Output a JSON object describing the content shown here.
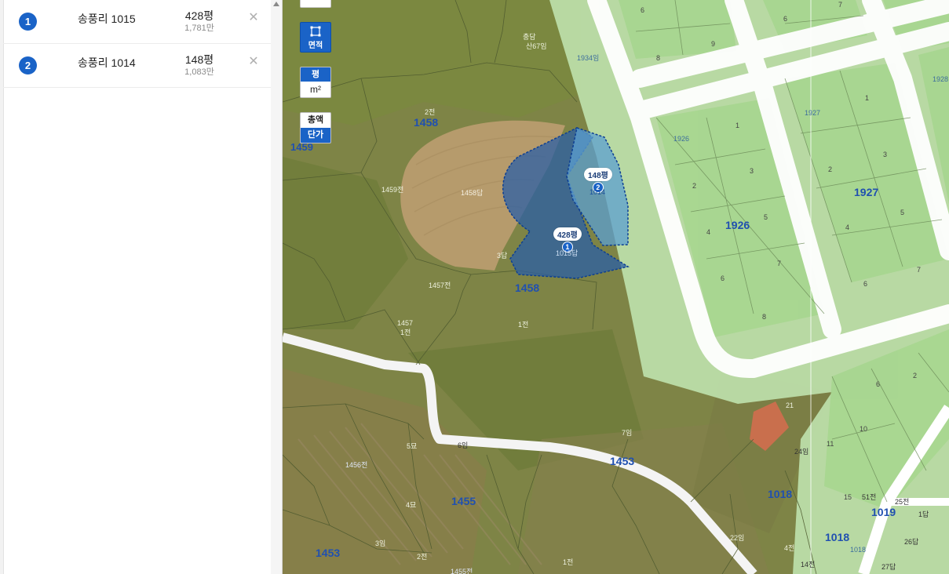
{
  "parcels": [
    {
      "index": "1",
      "name": "송풍리 1015",
      "area": "428평",
      "price": "1,781만"
    },
    {
      "index": "2",
      "name": "송풍리 1014",
      "area": "148평",
      "price": "1,083만"
    }
  ],
  "toolbar": {
    "area_label": "면적",
    "unit_pyeong": "평",
    "unit_sqm": "m²",
    "total_label": "총액",
    "unit_price_label": "단가"
  },
  "map_pins": [
    {
      "label": "428평",
      "index": "1"
    },
    {
      "label": "148평",
      "index": "2"
    }
  ],
  "map_labels": {
    "lot_1458_a": "1458",
    "lot_1458_b": "1458",
    "lot_1459": "1459",
    "lot_1453_a": "1453",
    "lot_1453_b": "1453",
    "lot_1455": "1455",
    "lot_1926": "1926",
    "lot_1927": "1927",
    "lot_1018_a": "1018",
    "lot_1018_b": "1018",
    "lot_1019": "1019",
    "sub_2jeon": "2전",
    "sub_1458dap": "1458답",
    "sub_1459jeon": "1459전",
    "sub_1457jeon": "1457전",
    "sub_1457": "1457",
    "sub_1jeon_a": "1전",
    "sub_1jeon_b": "1전",
    "sub_1jeon_c": "1전",
    "sub_3dap": "3답",
    "sub_1015dap": "1015답",
    "sub_1014": "1014",
    "sub_1934im": "1934임",
    "sub_sin67im": "산67임",
    "sub_chungdam": "충담",
    "sub_7im": "7임",
    "sub_6im": "6임",
    "sub_5myo": "5묘",
    "sub_4myo": "4묘",
    "sub_3im": "3임",
    "sub_2jeon_b": "2전",
    "sub_1456jeon": "1456전",
    "sub_1455jeon": "1455전",
    "sub_22im": "22임",
    "sub_21": "21",
    "sub_24im": "24임",
    "sub_4jeon": "4전",
    "sub_14jeon": "14전",
    "sub_51jeon": "51전",
    "sub_25jeon": "25전",
    "sub_1dap": "1답",
    "sub_26dap": "26답",
    "sub_27dap": "27답",
    "sub_1926s": "1926",
    "sub_1927s": "1927",
    "sub_1928s": "1928",
    "sub_1018s": "1018",
    "g6": "6",
    "g8": "8",
    "g9": "9",
    "g6b": "6",
    "g7": "7",
    "g1a": "1",
    "g3a": "3",
    "g2a": "2",
    "g5a": "5",
    "g4a": "4",
    "g7a": "7",
    "g6c": "6",
    "g8b": "8",
    "g1b": "1",
    "g2b": "2",
    "g3b": "3",
    "g4b": "4",
    "g5b": "5",
    "g6d": "6",
    "g7b": "7",
    "g6e": "6",
    "g2c": "2",
    "g10": "10",
    "g11": "11",
    "g15": "15"
  },
  "colors": {
    "accent": "#1a63c7",
    "parcel_fill_1": "#2b5fa6",
    "parcel_fill_2": "#5c9fd0",
    "district_fill": "#bfe2ad"
  }
}
